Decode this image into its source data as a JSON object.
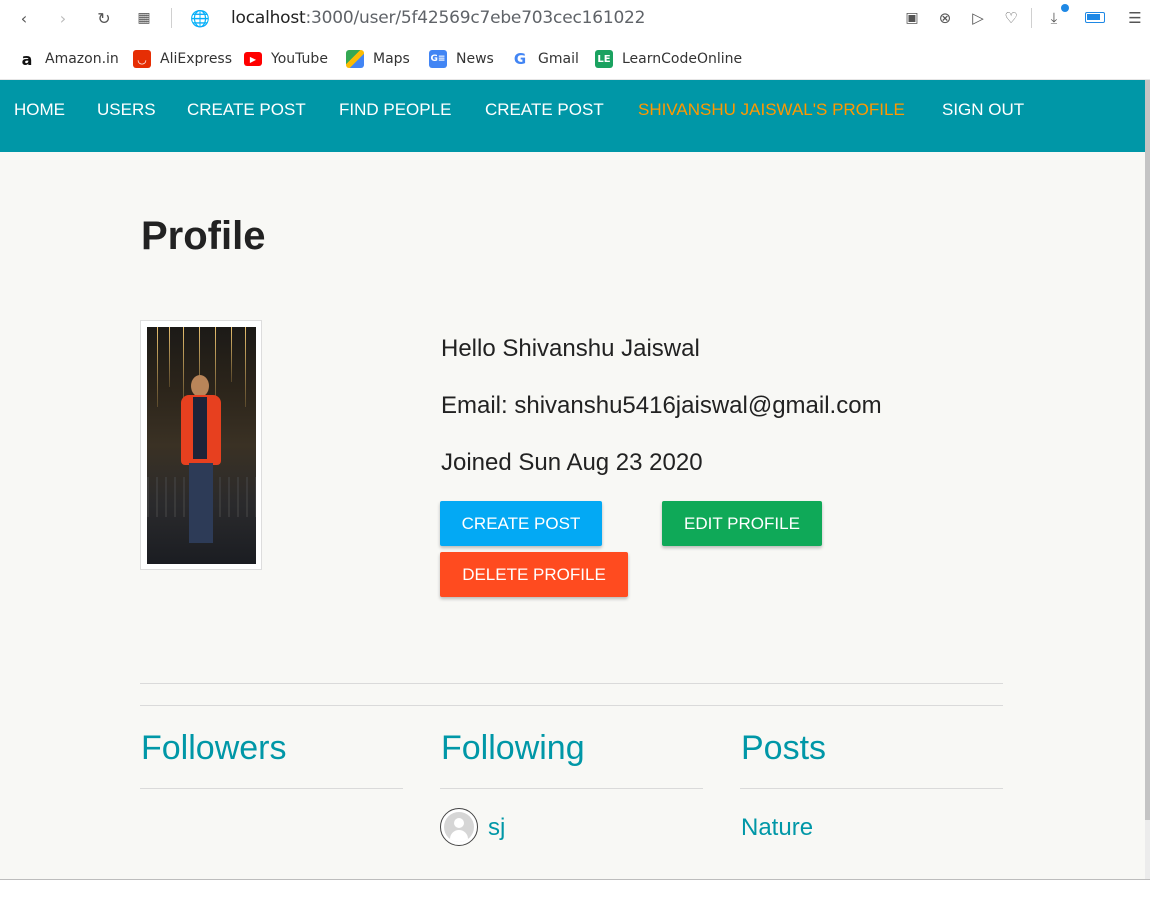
{
  "browser": {
    "url_host": "localhost",
    "url_path": ":3000/user/5f42569c7ebe703cec161022",
    "bookmarks": [
      {
        "label": "Amazon.in",
        "icon": "amazon-icon",
        "color": "#ffffff"
      },
      {
        "label": "AliExpress",
        "icon": "aliexpress-icon",
        "color": "#e62e04"
      },
      {
        "label": "YouTube",
        "icon": "youtube-icon",
        "color": "#ff0000"
      },
      {
        "label": "Maps",
        "icon": "maps-icon",
        "color": "#34a853"
      },
      {
        "label": "News",
        "icon": "news-icon",
        "color": "#4285f4"
      },
      {
        "label": "Gmail",
        "icon": "google-icon",
        "color": "#ffffff"
      },
      {
        "label": "LearnCodeOnline",
        "icon": "learncodeonline-icon",
        "color": "#1aa260"
      }
    ]
  },
  "nav": {
    "items": [
      "HOME",
      "USERS",
      "CREATE POST",
      "FIND PEOPLE",
      "CREATE POST",
      "SHIVANSHU JAISWAL'S PROFILE",
      "SIGN OUT"
    ],
    "active_index": 5,
    "bg_color": "#0097a7",
    "active_color": "#ff9800"
  },
  "profile": {
    "title": "Profile",
    "greeting": "Hello Shivanshu Jaiswal",
    "email": "Email: shivanshu5416jaiswal@gmail.com",
    "joined": "Joined Sun Aug 23 2020",
    "buttons": {
      "create_post": "CREATE POST",
      "edit_profile": "EDIT PROFILE",
      "delete_profile": "DELETE PROFILE"
    }
  },
  "sections": {
    "followers": {
      "title": "Followers",
      "items": []
    },
    "following": {
      "title": "Following",
      "items": [
        {
          "name": "sj"
        }
      ]
    },
    "posts": {
      "title": "Posts",
      "items": [
        {
          "title": "Nature"
        }
      ]
    }
  }
}
